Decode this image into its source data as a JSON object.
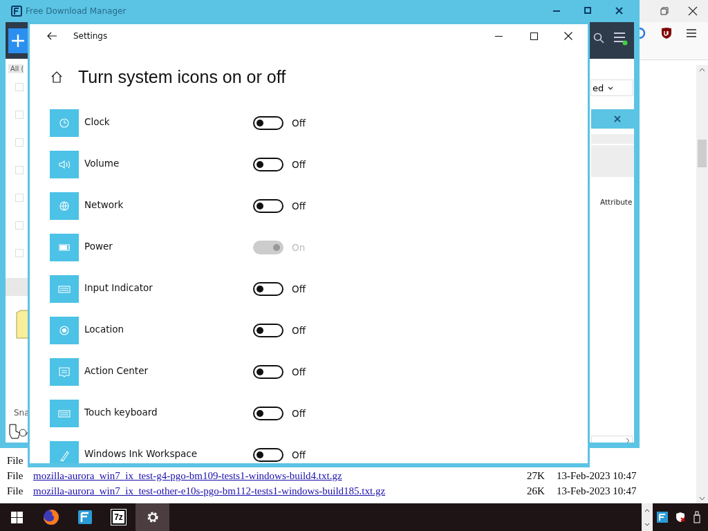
{
  "fdm_window": {
    "title": "Free Download Manager",
    "filter_tab": "All (",
    "sort_label": "ed",
    "snap_label": "Sna",
    "dialog_column": "Attribute",
    "row_checkboxes": [
      {
        "checked": false
      },
      {
        "checked": false
      },
      {
        "checked": false
      },
      {
        "checked": false
      },
      {
        "checked": false
      },
      {
        "checked": false
      },
      {
        "checked": false
      }
    ]
  },
  "settings_window": {
    "title": "Settings",
    "heading": "Turn system icons on or off",
    "items": [
      {
        "label": "Clock",
        "on": false,
        "disabled": false,
        "state_label": "Off"
      },
      {
        "label": "Volume",
        "on": false,
        "disabled": false,
        "state_label": "Off"
      },
      {
        "label": "Network",
        "on": false,
        "disabled": false,
        "state_label": "Off"
      },
      {
        "label": "Power",
        "on": true,
        "disabled": true,
        "state_label": "On"
      },
      {
        "label": "Input Indicator",
        "on": false,
        "disabled": false,
        "state_label": "Off"
      },
      {
        "label": "Location",
        "on": false,
        "disabled": false,
        "state_label": "Off"
      },
      {
        "label": "Action Center",
        "on": false,
        "disabled": false,
        "state_label": "Off"
      },
      {
        "label": "Touch keyboard",
        "on": false,
        "disabled": false,
        "state_label": "Off"
      },
      {
        "label": "Windows Ink Workspace",
        "on": false,
        "disabled": false,
        "state_label": "Off"
      }
    ]
  },
  "file_listing": [
    {
      "type": "File"
    },
    {
      "type": "File",
      "name": "mozilla-aurora_win7_ix_test-g4-pgo-bm109-tests1-windows-build4.txt.gz",
      "size": "27K",
      "date": "13-Feb-2023 10:47"
    },
    {
      "type": "File",
      "name": "mozilla-aurora_win7_ix_test-other-e10s-pgo-bm112-tests1-windows-build185.txt.gz",
      "size": "26K",
      "date": "13-Feb-2023 10:47"
    }
  ],
  "taskbar": {
    "apps": [
      {
        "kind": "firefox",
        "selected": false
      },
      {
        "kind": "fdm",
        "selected": false
      },
      {
        "kind": "archiver",
        "label": "7z",
        "selected": false
      },
      {
        "kind": "settings",
        "selected": true
      }
    ]
  }
}
